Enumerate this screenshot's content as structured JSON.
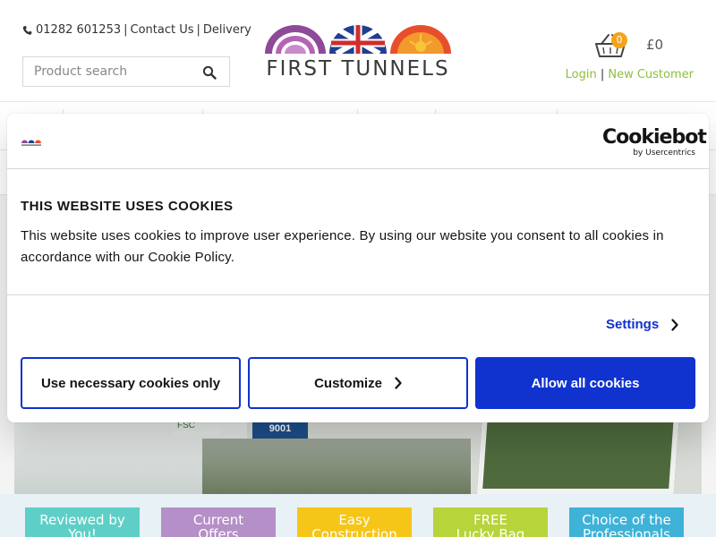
{
  "header": {
    "phone": "01282 601253",
    "contact_link": "Contact Us",
    "delivery_link": "Delivery",
    "search_placeholder": "Product search",
    "logo_text": "FIRST TUNNELS",
    "cart_count": "0",
    "cart_total": "£0",
    "login_link": "Login",
    "new_customer_link": "New Customer",
    "accent_color": "#8cbf3f"
  },
  "usps": [
    {
      "line1": "Reviewed by",
      "line2": "You!",
      "color": "#5ecfc6"
    },
    {
      "line1": "Current",
      "line2": "Offers",
      "color": "#b58fc7"
    },
    {
      "line1": "Easy",
      "line2": "Construction",
      "color": "#f5c518"
    },
    {
      "line1": "FREE",
      "line2": "Lucky Bag",
      "color": "#b7d43a"
    },
    {
      "line1": "Choice of the",
      "line2": "Professionals",
      "color": "#3fb2d8"
    }
  ],
  "banner": {
    "badge_9001": "9001",
    "fsc_label": "FSC"
  },
  "cookie_dialog": {
    "brand_name": "Cookiebot",
    "brand_by": "by Usercentrics",
    "title": "THIS WEBSITE USES COOKIES",
    "body": "This website uses cookies to improve user experience. By using our website you consent to all cookies in accordance with our Cookie Policy.",
    "settings_label": "Settings",
    "btn_necessary": "Use necessary cookies only",
    "btn_customize": "Customize",
    "btn_allow": "Allow all cookies",
    "primary_color": "#1032cf"
  }
}
